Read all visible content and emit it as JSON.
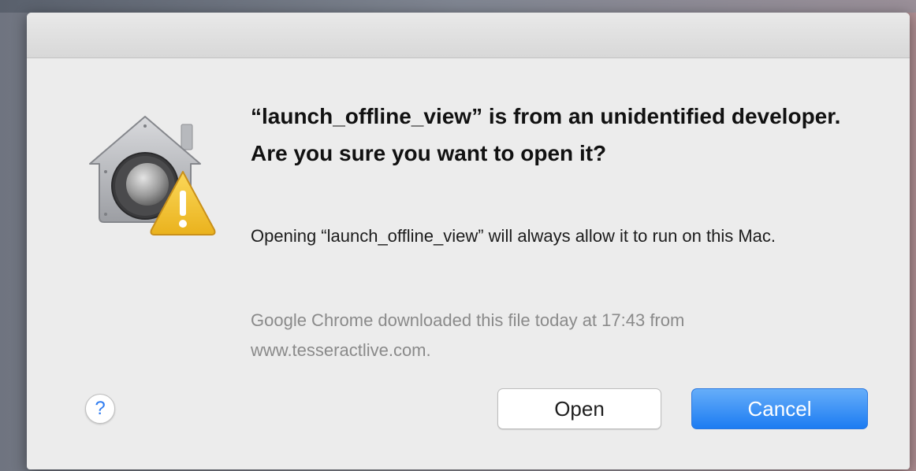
{
  "dialog": {
    "headline": "“launch_offline_view” is from an unidentified developer. Are you sure you want to open it?",
    "body": "Opening “launch_offline_view” will always allow it to run on this Mac.",
    "source": "Google Chrome downloaded this file today at 17:43 from www.tesseractlive.com.",
    "icon": "gatekeeper-security-icon",
    "warning_icon": "warning-icon",
    "help_label": "?",
    "buttons": {
      "open_label": "Open",
      "cancel_label": "Cancel"
    }
  },
  "colors": {
    "dialog_background": "#ececec",
    "accent": "#1c7cf2",
    "secondary_text": "#8a8a8a",
    "warning": "#f5c527"
  }
}
